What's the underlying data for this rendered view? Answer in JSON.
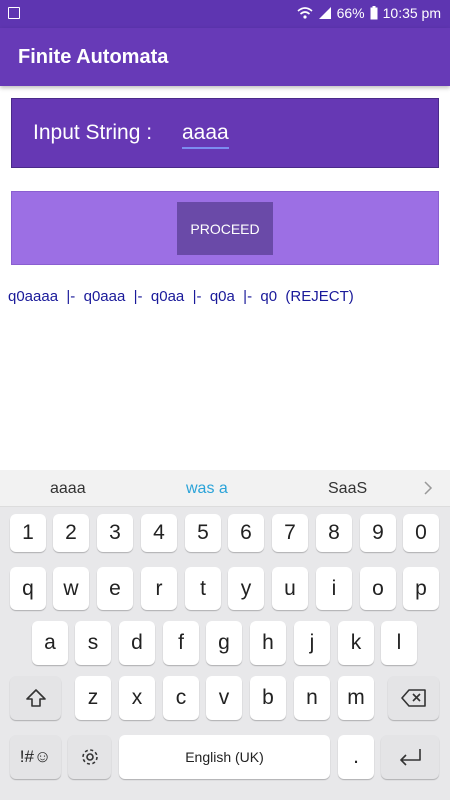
{
  "status_bar": {
    "battery_percent": "66%",
    "time": "10:35 pm"
  },
  "app_bar": {
    "title": "Finite Automata"
  },
  "input": {
    "label": "Input String :",
    "value": "aaaa"
  },
  "proceed": {
    "label": "PROCEED"
  },
  "result": {
    "text": "q0aaaa  |-  q0aaa  |-  q0aa  |-  q0a  |-  q0  (REJECT)"
  },
  "keyboard": {
    "suggestions": [
      "aaaa",
      "was a",
      "SaaS"
    ],
    "suggestion_accent": "#2BA3D8",
    "row_numbers": [
      "1",
      "2",
      "3",
      "4",
      "5",
      "6",
      "7",
      "8",
      "9",
      "0"
    ],
    "row_q": [
      "q",
      "w",
      "e",
      "r",
      "t",
      "y",
      "u",
      "i",
      "o",
      "p"
    ],
    "row_a": [
      "a",
      "s",
      "d",
      "f",
      "g",
      "h",
      "j",
      "k",
      "l"
    ],
    "row_z": [
      "z",
      "x",
      "c",
      "v",
      "b",
      "n",
      "m"
    ],
    "symbols_label": "!#☺",
    "space_label": "English (UK)",
    "period_label": "."
  },
  "colors": {
    "status_bar": "#5E35B1",
    "app_bar": "#673AB7",
    "input_panel": "#6638B4",
    "proceed_panel": "#9C6FE4",
    "result_text": "#1A1A9A"
  }
}
